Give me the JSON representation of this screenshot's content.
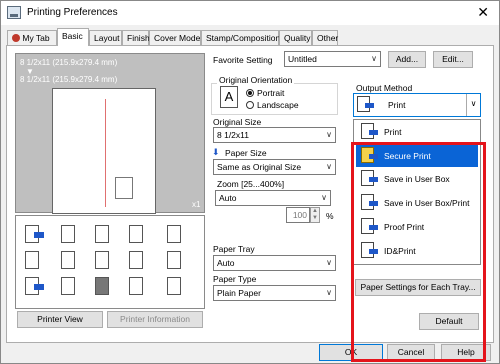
{
  "window": {
    "title": "Printing Preferences",
    "close_glyph": "✕"
  },
  "tabs": [
    {
      "label": "My Tab"
    },
    {
      "label": "Basic"
    },
    {
      "label": "Layout"
    },
    {
      "label": "Finish"
    },
    {
      "label": "Cover Mode"
    },
    {
      "label": "Stamp/Composition"
    },
    {
      "label": "Quality"
    },
    {
      "label": "Other"
    }
  ],
  "active_tab": "Basic",
  "preview": {
    "line1": "8 1/2x11 (215.9x279.4 mm)",
    "arrow": "▼",
    "line2": "8 1/2x11 (215.9x279.4 mm)",
    "copies": "x1"
  },
  "buttons": {
    "printer_view": "Printer View",
    "printer_information": "Printer Information",
    "add": "Add...",
    "edit": "Edit...",
    "paper_settings": "Paper Settings for Each Tray...",
    "default": "Default",
    "ok": "OK",
    "cancel": "Cancel",
    "help": "Help"
  },
  "favorite": {
    "label": "Favorite Setting",
    "value": "Untitled"
  },
  "original_orientation": {
    "label": "Original Orientation",
    "portrait": "Portrait",
    "landscape": "Landscape",
    "icon_letter": "A"
  },
  "original_size": {
    "label": "Original Size",
    "value": "8 1/2x11"
  },
  "paper_size": {
    "label": "Paper Size",
    "value": "Same as Original Size"
  },
  "zoom": {
    "label": "Zoom [25...400%]",
    "value": "Auto",
    "percent": "100",
    "unit": "%"
  },
  "paper_tray": {
    "label": "Paper Tray",
    "value": "Auto"
  },
  "paper_type": {
    "label": "Paper Type",
    "value": "Plain Paper"
  },
  "output_method": {
    "label": "Output Method",
    "value": "Print",
    "options": [
      "Print",
      "Secure Print",
      "Save in User Box",
      "Save in User Box/Print",
      "Proof Print",
      "ID&Print"
    ],
    "selected": "Secure Print"
  },
  "colors": {
    "highlight": "#0a64d6",
    "callout": "#e4141b",
    "arrow_blue": "#1e57c8"
  }
}
